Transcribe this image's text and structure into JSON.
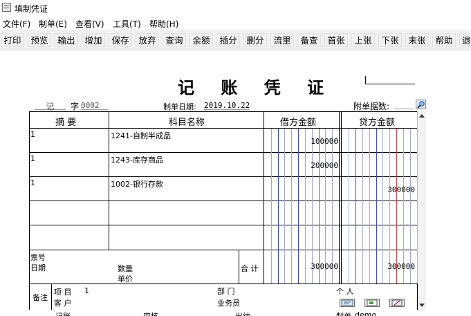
{
  "window": {
    "title": "填制凭证"
  },
  "menu": [
    "文件(F)",
    "制单(E)",
    "查看(V)",
    "工具(T)",
    "帮助(H)"
  ],
  "toolbar": [
    "打印",
    "预览",
    "输出",
    "增加",
    "保存",
    "放弃",
    "查询",
    "余额",
    "插分",
    "删分",
    "流里",
    "备查",
    "首张",
    "上张",
    "下张",
    "末张",
    "帮助",
    "退出"
  ],
  "voucher": {
    "title": "记 账 凭 证",
    "type": "记",
    "zi": "字",
    "number": "0002",
    "date_label": "制单日期:",
    "date": "2019.10.22",
    "attach_label": "附单据数:",
    "headers": {
      "summary": "摘 要",
      "account": "科目名称",
      "debit": "借方金额",
      "credit": "贷方金额"
    },
    "rows": [
      {
        "summary": "1",
        "account": "1241-自制半成品",
        "debit": "100000",
        "credit": ""
      },
      {
        "summary": "1",
        "account": "1243-库存商品",
        "debit": "200000",
        "credit": ""
      },
      {
        "summary": "1",
        "account": "1002-银行存款",
        "debit": "",
        "credit": "300000"
      },
      {
        "summary": "",
        "account": "",
        "debit": "",
        "credit": ""
      },
      {
        "summary": "",
        "account": "",
        "debit": "",
        "credit": ""
      }
    ],
    "footer": {
      "ticket_label": "票号",
      "date_label": "日期",
      "qty_label": "数量",
      "price_label": "单价",
      "total_label": "合 计",
      "total_debit": "300000",
      "total_credit": "300000"
    },
    "remarks": {
      "label": "备注",
      "project_label": "项  目",
      "project_value": "1",
      "customer_label": "客  户",
      "dept_label": "部  门",
      "staff_label": "业务员",
      "person_label": "个  人"
    },
    "signatures": {
      "bookkeeper": "记账",
      "auditor": "审核",
      "cashier": "出纳",
      "maker": "制单",
      "maker_value": "demo"
    }
  }
}
